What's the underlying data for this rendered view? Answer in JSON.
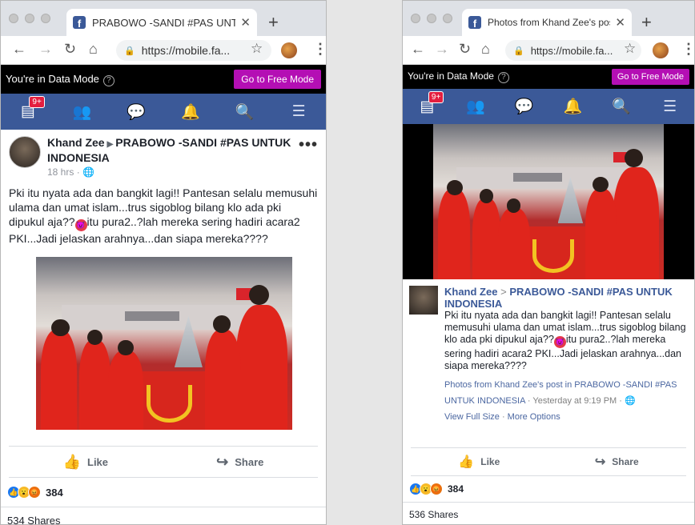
{
  "left": {
    "tab_title": "PRABOWO -SANDI #PAS UNTUK",
    "url": "https://mobile.fa...",
    "data_mode": {
      "text": "You're in Data Mode",
      "button": "Go to Free Mode"
    },
    "nav_badge": "9+",
    "post": {
      "author": "Khand Zee",
      "group": "PRABOWO -SANDI #PAS UNTUK INDONESIA",
      "time": "18 hrs",
      "text_part1": "Pki itu nyata ada dan bangkit lagi!! Pantesan selalu memusuhi ulama dan umat islam...trus sigoblog bilang klo ada pki dipukul aja??",
      "text_part2": "itu pura2..?lah mereka sering hadiri acara2 PKI...Jadi jelaskan arahnya...dan siapa mereka????",
      "like_label": "Like",
      "share_label": "Share",
      "reactions_count": "384",
      "shares_text": "534 Shares"
    }
  },
  "right": {
    "tab_title": "Photos from Khand Zee's post",
    "url": "https://mobile.fa...",
    "data_mode": {
      "text": "You're in Data Mode",
      "button": "Go to Free Mode"
    },
    "nav_badge": "9+",
    "caption": {
      "author": "Khand Zee",
      "separator": ">",
      "group": "PRABOWO -SANDI #PAS UNTUK INDONESIA",
      "text_part1": "Pki itu nyata ada dan bangkit lagi!! Pantesan selalu memusuhi ulama dan umat islam...trus sigoblog bilang klo ada pki dipukul aja??",
      "text_part2": "itu pura2..?lah mereka sering hadiri acara2 PKI...Jadi jelaskan arahnya...dan siapa mereka????",
      "album_link": "Photos from Khand Zee's post in PRABOWO -SANDI #PAS UNTUK INDONESIA",
      "album_time": " · Yesterday at 9:19 PM · ",
      "view_full": "View Full Size",
      "more_options": "More Options"
    },
    "like_label": "Like",
    "share_label": "Share",
    "reactions_count": "384",
    "shares_text": "536 Shares"
  }
}
